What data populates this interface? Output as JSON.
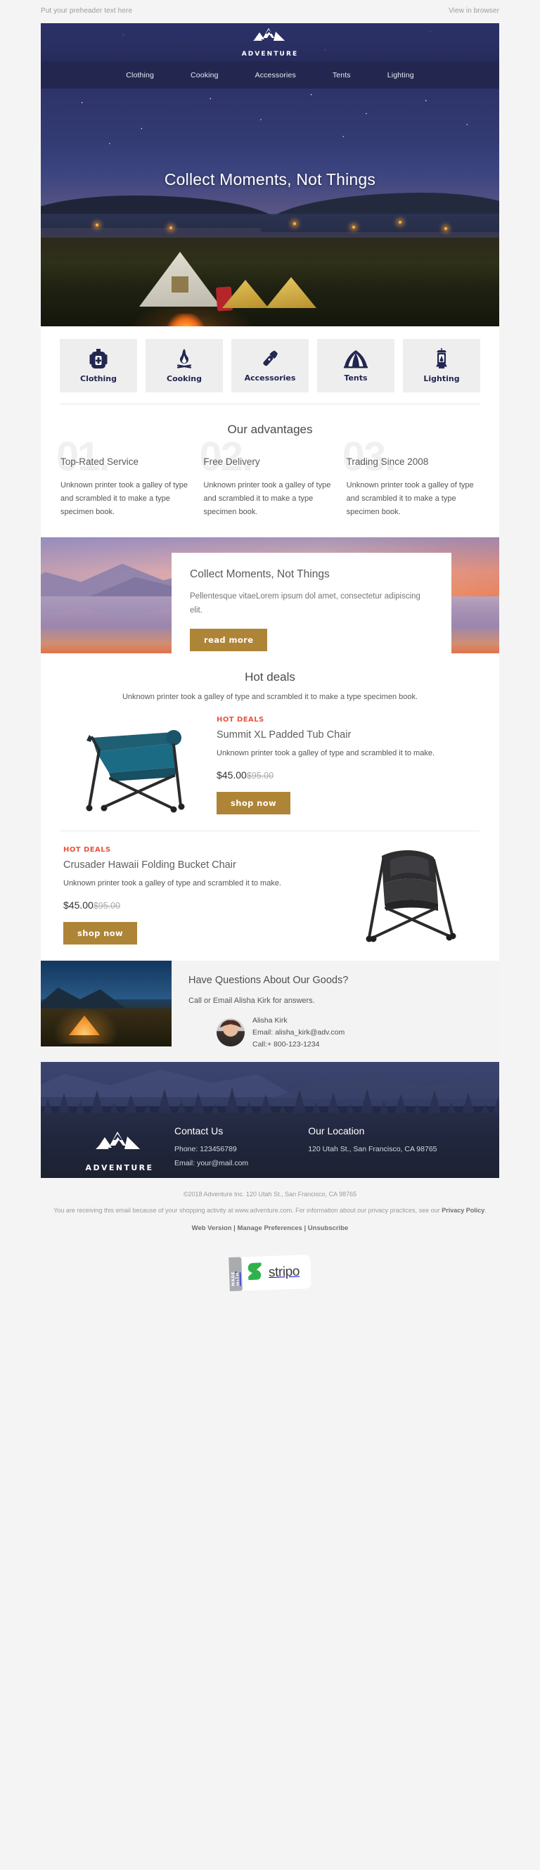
{
  "preheader": {
    "text": "Put your preheader text here",
    "view_in_browser": "View in browser"
  },
  "brand": {
    "name": "ADVENTURE",
    "logo_icon": "mountain-logo-icon"
  },
  "nav": {
    "items": [
      {
        "label": "Clothing"
      },
      {
        "label": "Cooking"
      },
      {
        "label": "Accessories"
      },
      {
        "label": "Tents"
      },
      {
        "label": "Lighting"
      }
    ]
  },
  "hero": {
    "title": "Collect Moments, Not Things"
  },
  "categories": [
    {
      "label": "Clothing",
      "icon": "backpack-icon"
    },
    {
      "label": "Cooking",
      "icon": "campfire-icon"
    },
    {
      "label": "Accessories",
      "icon": "flashlight-icon"
    },
    {
      "label": "Tents",
      "icon": "tent-icon"
    },
    {
      "label": "Lighting",
      "icon": "lantern-icon"
    }
  ],
  "advantages": {
    "title": "Our advantages",
    "items": [
      {
        "number": "01.",
        "heading": "Top-Rated Service",
        "body": "Unknown printer took a galley of type and scrambled it to make a type specimen book."
      },
      {
        "number": "02.",
        "heading": "Free Delivery",
        "body": "Unknown printer took a galley of type and scrambled it to make a type specimen book."
      },
      {
        "number": "03.",
        "heading": "Trading Since 2008",
        "body": "Unknown printer took a galley of type and scrambled it to make a type specimen book."
      }
    ]
  },
  "promo": {
    "heading": "Collect Moments, Not Things",
    "body": "Pellentesque vitaeLorem ipsum dol amet, consectetur adipiscing elit.",
    "button_label": "read more"
  },
  "hot_deals": {
    "title": "Hot deals",
    "subtitle": "Unknown printer took a galley of type and scrambled it to make a type specimen book.",
    "products": [
      {
        "tag": "HOT DEALS",
        "name": "Summit XL Padded Tub Chair",
        "description": "Unknown printer took a galley of type and scrambled it to make.",
        "price": "$45.00",
        "old_price": "$95.00",
        "button_label": "shop now",
        "image_alt": "teal-folding-camp-chair"
      },
      {
        "tag": "HOT DEALS",
        "name": "Crusader Hawaii Folding Bucket Chair",
        "description": "Unknown printer took a galley of type and scrambled it to make.",
        "price": "$45.00",
        "old_price": "$95.00",
        "button_label": "shop now",
        "image_alt": "black-folding-bucket-chair"
      }
    ]
  },
  "questions": {
    "heading": "Have Questions About Our Goods?",
    "body": "Call or Email Alisha Kirk for answers.",
    "contact": {
      "name": "Alisha Kirk",
      "email": "Email: alisha_kirk@adv.com",
      "phone": "Call:+ 800-123-1234"
    }
  },
  "footer": {
    "contact": {
      "title": "Contact Us",
      "phone": "Phone: 123456789",
      "email": "Email: your@mail.com"
    },
    "location": {
      "title": "Our Location",
      "address": "120 Utah St., San Francisco, CA 98765"
    }
  },
  "legal": {
    "copyright": "©2018 Adventure Inc. 120 Utah St., San Francisco, CA 98765",
    "notice_part1": "You are receiving this email because of your shopping activity at www.adventure.com. For information about our privacy practices, see our ",
    "privacy_policy": "Privacy Policy",
    "notice_end": ".",
    "web_version": "Web Version",
    "sep1": " | ",
    "manage_preferences": "Manage Preferences",
    "sep2": " | ",
    "unsubscribe": "Unsubscribe"
  },
  "stripo": {
    "made_with": "MADE WITH",
    "name": "stripo",
    "logo_color": "#2fb24c"
  },
  "colors": {
    "navy": "#232750",
    "gold": "#ae8437",
    "hot_tag": "#e8543f",
    "page_bg": "#f4f4f4"
  }
}
